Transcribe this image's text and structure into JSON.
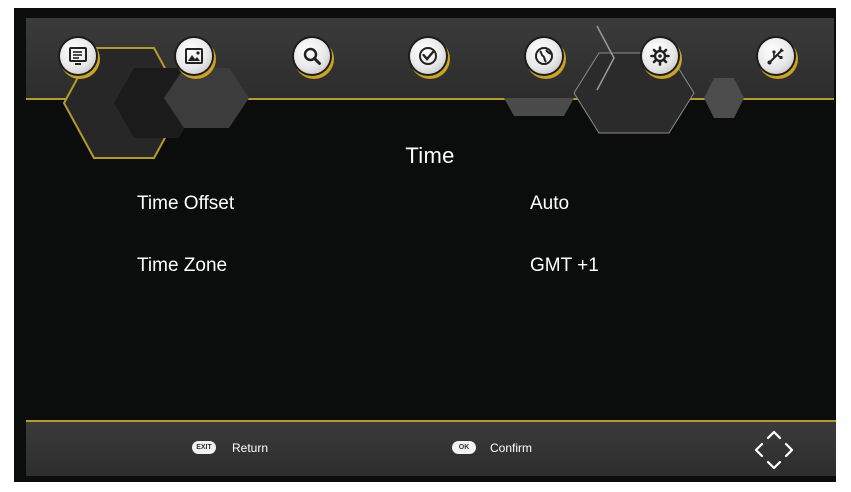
{
  "menu": {
    "items": [
      {
        "icon": "program-list-icon"
      },
      {
        "icon": "picture-icon"
      },
      {
        "icon": "search-icon"
      },
      {
        "icon": "clock-icon"
      },
      {
        "icon": "globe-icon"
      },
      {
        "icon": "gear-icon"
      },
      {
        "icon": "usb-icon"
      }
    ],
    "active_index": 3
  },
  "page": {
    "title": "Time",
    "rows": [
      {
        "label": "Time Offset",
        "value": "Auto"
      },
      {
        "label": "Time Zone",
        "value": "GMT +1"
      }
    ]
  },
  "footer": {
    "return_key": "EXIT",
    "return_label": "Return",
    "confirm_key": "OK",
    "confirm_label": "Confirm",
    "nav_icon": "navigation-arrows-icon"
  },
  "colors": {
    "accent": "#b59a2d",
    "icon_accent": "#c9a227",
    "background": "#0b0c0c",
    "bar": "#333433"
  }
}
